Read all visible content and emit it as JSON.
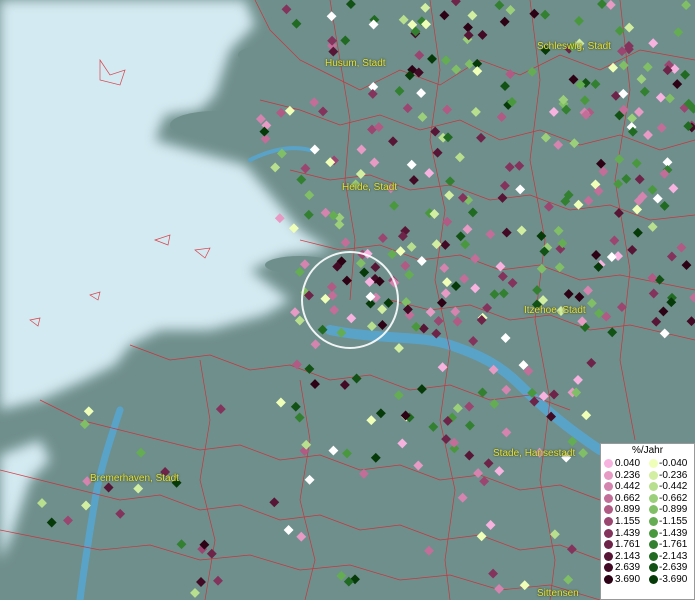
{
  "map": {
    "cities": [
      {
        "name": "Husum, Stadt"
      },
      {
        "name": "Schleswig, Stadt"
      },
      {
        "name": "Heide, Stadt"
      },
      {
        "name": "Itzehoe, Stadt"
      },
      {
        "name": "Stade, Hansestadt"
      },
      {
        "name": "Bremerhaven, Stadt"
      },
      {
        "name": "Sittensen"
      }
    ],
    "colors": {
      "land": "#6f8f8c",
      "sea": "#d4eaf2",
      "river": "#5aa3c8",
      "border": "#d8262e",
      "city_label": "#e6e23a"
    }
  },
  "legend": {
    "title": "%/Jahr",
    "rows": [
      {
        "pos": "0.040",
        "neg": "-0.040",
        "pos_color": "#f7b2e0",
        "neg_color": "#efffb8"
      },
      {
        "pos": "0.236",
        "neg": "-0.236",
        "pos_color": "#e69ac4",
        "neg_color": "#d2eea0"
      },
      {
        "pos": "0.442",
        "neg": "-0.442",
        "pos_color": "#d484ae",
        "neg_color": "#b8df8e"
      },
      {
        "pos": "0.662",
        "neg": "-0.662",
        "pos_color": "#c26e98",
        "neg_color": "#9ccf7a"
      },
      {
        "pos": "0.899",
        "neg": "-0.899",
        "pos_color": "#b05a84",
        "neg_color": "#80bf66"
      },
      {
        "pos": "1.155",
        "neg": "-1.155",
        "pos_color": "#9a4670",
        "neg_color": "#64ad52"
      },
      {
        "pos": "1.439",
        "neg": "-1.439",
        "pos_color": "#84345c",
        "neg_color": "#4a983e"
      },
      {
        "pos": "1.761",
        "neg": "-1.761",
        "pos_color": "#6e2448",
        "neg_color": "#338030"
      },
      {
        "pos": "2.143",
        "neg": "-2.143",
        "pos_color": "#581636",
        "neg_color": "#206a22"
      },
      {
        "pos": "2.639",
        "neg": "-2.639",
        "pos_color": "#420a24",
        "neg_color": "#125214"
      },
      {
        "pos": "3.690",
        "neg": "-3.690",
        "pos_color": "#2c0214",
        "neg_color": "#063a08"
      }
    ]
  }
}
